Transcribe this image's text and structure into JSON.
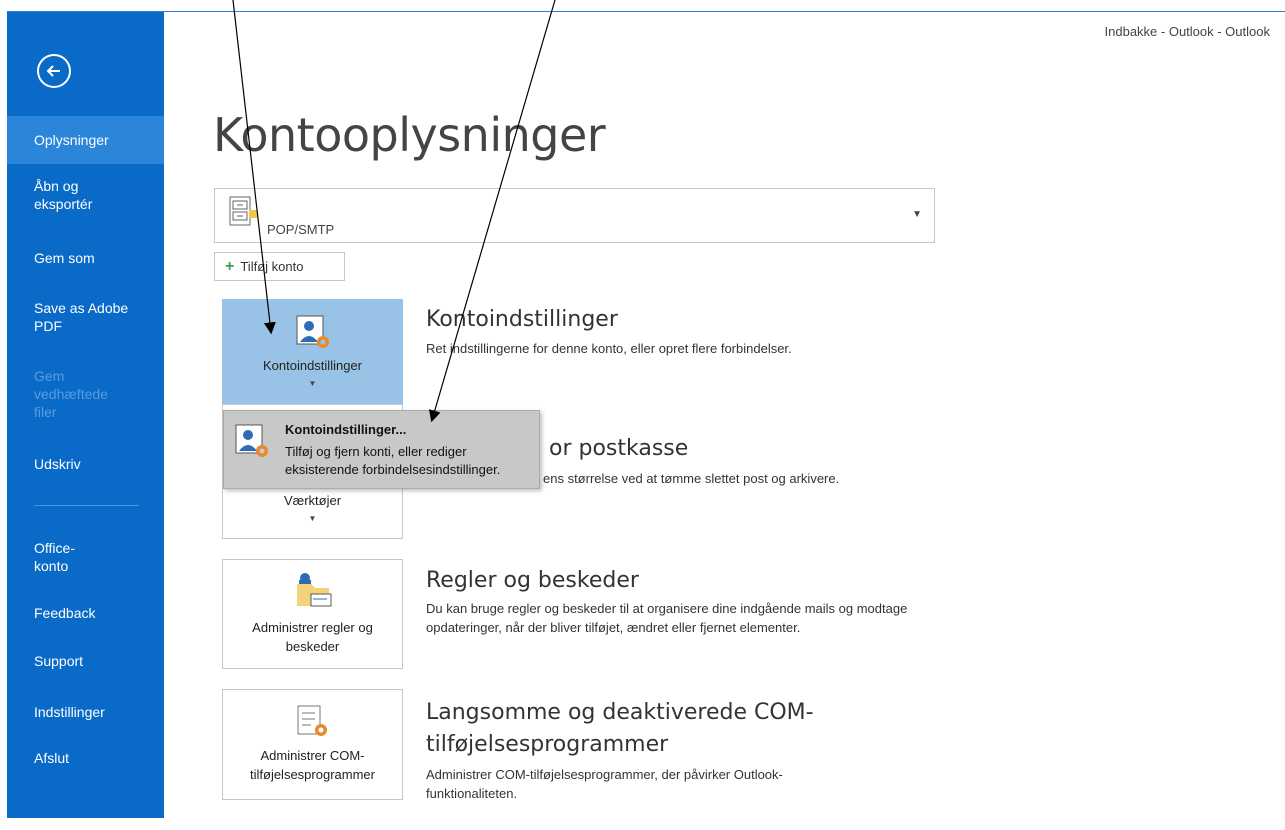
{
  "window": {
    "title": "Indbakke - Outlook - Outlook"
  },
  "sidebar": {
    "items": [
      {
        "label": "Oplysninger"
      },
      {
        "label": "Åbn og eksportér"
      },
      {
        "label": "Gem som"
      },
      {
        "label": "Save as Adobe PDF"
      },
      {
        "label": "Gem vedhæftede filer"
      },
      {
        "label": "Udskriv"
      },
      {
        "label": "Office-konto"
      },
      {
        "label": "Feedback"
      },
      {
        "label": "Support"
      },
      {
        "label": "Indstillinger"
      },
      {
        "label": "Afslut"
      }
    ]
  },
  "main": {
    "title": "Kontooplysninger",
    "account": {
      "type": "POP/SMTP"
    },
    "add_account_label": "Tilføj konto",
    "sections": [
      {
        "tile_label": "Kontoindstillinger",
        "title": "Kontoindstillinger",
        "desc": "Ret indstillingerne for denne konto, eller opret flere forbindelser."
      },
      {
        "tile_label": "Værktøjer",
        "title": "Indstillinger for postkasse",
        "title_visible": "or postkasse",
        "desc_visible": "ens størrelse ved at tømme slettet post og arkivere."
      },
      {
        "tile_label": "Administrer regler og beskeder",
        "title": "Regler og beskeder",
        "desc": "Du kan bruge regler og beskeder til at organisere dine indgående mails og modtage opdateringer, når der bliver tilføjet, ændret eller fjernet elementer."
      },
      {
        "tile_label": "Administrer COM-tilføjelsesprogrammer",
        "title": "Langsomme og deaktiverede COM-tilføjelsesprogrammer",
        "desc": "Administrer COM-tilføjelsesprogrammer, der påvirker Outlook-funktionaliteten."
      }
    ]
  },
  "popup": {
    "title": "Kontoindstillinger...",
    "desc": "Tilføj og fjern konti, eller rediger eksisterende forbindelsesindstillinger."
  },
  "colors": {
    "sidebar": "#0a6ac8",
    "sidebar_active": "#2b86d9",
    "tile_selected": "#98c3e6"
  }
}
